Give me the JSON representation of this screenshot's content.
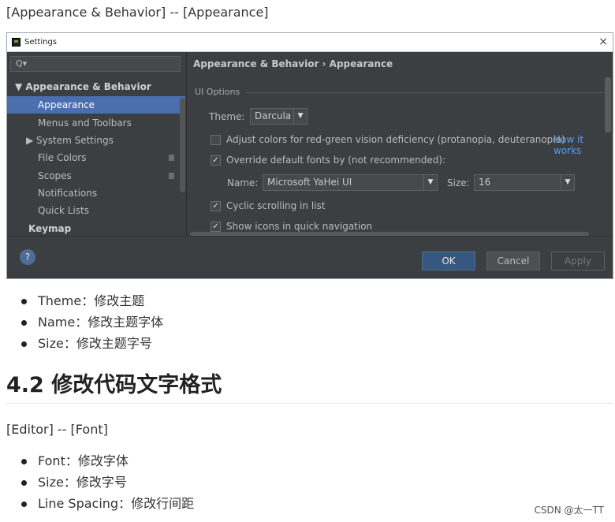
{
  "top_breadcrumb": "[Appearance & Behavior] -- [Appearance]",
  "window": {
    "title": "Settings",
    "close": "×",
    "search_icon": "Q▾",
    "nav": [
      {
        "label": "▼  Appearance & Behavior",
        "bold": true
      },
      {
        "label": "Appearance",
        "selected": true
      },
      {
        "label": "Menus and Toolbars"
      },
      {
        "label": "▶  System Settings"
      },
      {
        "label": "File Colors"
      },
      {
        "label": "Scopes"
      },
      {
        "label": "Notifications"
      },
      {
        "label": "Quick Lists"
      },
      {
        "label": "Keymap",
        "bold": true
      }
    ],
    "breadcrumb": "Appearance & Behavior  ›  Appearance",
    "group_title": "UI Options",
    "theme_label": "Theme:",
    "theme_value": "Darcula",
    "adjust_colors": "Adjust colors for red-green vision deficiency (protanopia, deuteranopia)",
    "how_it_works": "How it works",
    "override_fonts": "Override default fonts by (not recommended):",
    "name_label": "Name:",
    "name_value": "Microsoft YaHei UI",
    "size_label": "Size:",
    "size_value": "16",
    "cyclic_scrolling": "Cyclic scrolling in list",
    "show_icons": "Show icons in quick navigation",
    "checks": {
      "adjust": false,
      "override": true,
      "cyclic": true,
      "icons": true
    },
    "help": "?",
    "ok": "OK",
    "cancel": "Cancel",
    "apply": "Apply"
  },
  "list1": [
    "Theme：修改主题",
    "Name：修改主题字体",
    "Size：修改主题字号"
  ],
  "heading": "4.2 修改代码文字格式",
  "editor_breadcrumb": "[Editor] -- [Font]",
  "list2": [
    "Font：修改字体",
    "Size：修改字号",
    "Line Spacing：修改行间距"
  ],
  "credit": "CSDN @太一TT"
}
